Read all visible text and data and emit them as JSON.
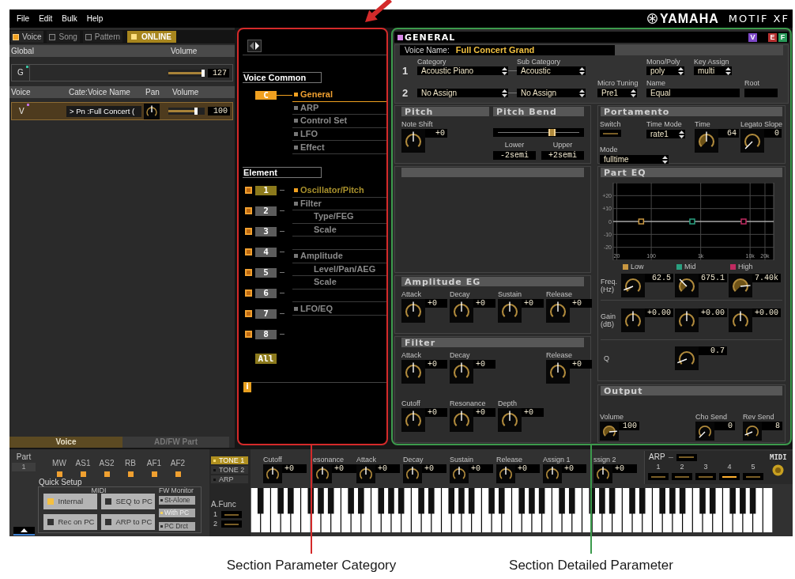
{
  "menu": [
    {
      "label": "File"
    },
    {
      "label": "Edit"
    },
    {
      "label": "Bulk"
    },
    {
      "label": "Help"
    }
  ],
  "logo": {
    "brand": "YAMAHA",
    "model": "MOTIF XF"
  },
  "mode_tabs": [
    {
      "label": "Voice",
      "selected": true
    },
    {
      "label": "Song",
      "selected": false
    },
    {
      "label": "Pattern",
      "selected": false
    }
  ],
  "online": {
    "label": "ONLINE",
    "on": true
  },
  "global": {
    "header": "Global",
    "volume_header": "Volume",
    "row": {
      "label": "G",
      "volume": {
        "value": "127",
        "level": 1
      }
    }
  },
  "voice_list": {
    "columns": [
      "Voice",
      "Cate:Voice Name",
      "Pan",
      "Volume"
    ],
    "rows": [
      {
        "label": "V",
        "name": "> Pn :Full Concert (",
        "selected": true,
        "pan": {
          "kind": "center"
        },
        "volume": {
          "value": "100",
          "level": 0.79
        }
      }
    ]
  },
  "left_tabs": [
    {
      "label": "Voice",
      "selected": true
    },
    {
      "label": "AD/FW Part",
      "selected": false
    }
  ],
  "category": {
    "common": {
      "title": "Voice Common",
      "button": {
        "label": "C",
        "selected": true
      },
      "items": [
        {
          "label": "General",
          "selected": true
        },
        {
          "label": "ARP",
          "selected": false
        },
        {
          "label": "Control Set",
          "selected": false
        },
        {
          "label": "LFO",
          "selected": false
        },
        {
          "label": "Effect",
          "selected": false
        }
      ]
    },
    "element": {
      "title": "Element",
      "buttons": [
        {
          "label": "1",
          "selected": true,
          "checked": true
        },
        {
          "label": "2",
          "selected": false,
          "checked": true
        },
        {
          "label": "3",
          "selected": false,
          "checked": true
        },
        {
          "label": "4",
          "selected": false,
          "checked": true
        },
        {
          "label": "5",
          "selected": false,
          "checked": true
        },
        {
          "label": "6",
          "selected": false,
          "checked": true
        },
        {
          "label": "7",
          "selected": false,
          "checked": true
        },
        {
          "label": "8",
          "selected": false,
          "checked": true
        }
      ],
      "all_button": {
        "label": "All"
      },
      "items": [
        {
          "label": "Oscillator/Pitch",
          "selected": true
        },
        {
          "label": "Filter",
          "selected": false,
          "children": [
            {
              "label": "Type/FEG",
              "selected": false
            },
            {
              "label": "Scale",
              "selected": false
            }
          ]
        },
        {
          "label": "Amplitude",
          "selected": false,
          "children": [
            {
              "label": "Level/Pan/AEG",
              "selected": false
            },
            {
              "label": "Scale",
              "selected": false
            }
          ]
        },
        {
          "label": "LFO/EQ",
          "selected": false
        }
      ]
    },
    "info_button": {
      "label": "i"
    }
  },
  "detail": {
    "title": "GENERAL",
    "badges": [
      {
        "label": "V",
        "color": "#7e48c8"
      },
      {
        "label": "E",
        "color": "#b83232"
      },
      {
        "label": "F",
        "color": "#2a9a5a"
      }
    ],
    "voice_name": {
      "label": "Voice Name:",
      "value": "Full Concert Grand"
    },
    "category_headers": [
      "Category",
      "Sub Category"
    ],
    "category_rows": [
      {
        "index": "1",
        "category": "Acoustic Piano",
        "sub_category": "Acoustic"
      },
      {
        "index": "2",
        "category": "No Assign",
        "sub_category": "No Assign"
      }
    ],
    "mono_poly": {
      "label": "Mono/Poly",
      "value": "poly"
    },
    "key_assign": {
      "label": "Key Assign",
      "value": "multi"
    },
    "micro_tuning": {
      "label": "Micro Tuning",
      "value": "Pre1"
    },
    "tuning_name": {
      "label": "Name",
      "value": "Equal"
    },
    "root": {
      "label": "Root"
    },
    "pitch": {
      "title": "Pitch",
      "note_shift": {
        "label": "Note Shift",
        "value": "+0",
        "kind": "center"
      }
    },
    "pitch_bend": {
      "title": "Pitch Bend",
      "level": 0.64,
      "lower": {
        "label": "Lower",
        "value": "-2semi"
      },
      "upper": {
        "label": "Upper",
        "value": "+2semi"
      }
    },
    "portamento": {
      "title": "Portamento",
      "switch": {
        "label": "Switch",
        "on": false
      },
      "time_mode": {
        "label": "Time Mode",
        "value": "rate1"
      },
      "time": {
        "label": "Time",
        "value": "64",
        "kind": "center",
        "filled": true
      },
      "legato_slope": {
        "label": "Legato Slope",
        "value": "0",
        "kind": "min"
      },
      "mode": {
        "label": "Mode",
        "value": "fulltime"
      }
    },
    "part_eq": {
      "title": "Part EQ",
      "chart_data": [
        {
          "type": "scatter",
          "log": "x",
          "grid": true,
          "xlim": [
            17,
            30000
          ],
          "ylim": [
            -30,
            30
          ],
          "xticks": [
            {
              "value": 20,
              "label": "20"
            },
            {
              "value": 100,
              "label": "100"
            },
            {
              "value": 1000,
              "label": "1k"
            },
            {
              "value": 10000,
              "label": "10k"
            },
            {
              "value": 20000,
              "label": "20k"
            }
          ],
          "yticks": [
            {
              "value": 20,
              "label": "+20"
            },
            {
              "value": 10,
              "label": "+10"
            },
            {
              "value": 0,
              "label": "0"
            },
            {
              "value": -10,
              "label": "-10"
            },
            {
              "value": -20,
              "label": "-20"
            }
          ],
          "series": [
            {
              "type": "line",
              "x": [
                17,
                30000
              ],
              "values": [
                0,
                0
              ],
              "color": "#d8d8d8"
            },
            {
              "name": "Low",
              "x": [
                62.5
              ],
              "values": [
                0
              ],
              "color": "#c89640",
              "marker": "square"
            },
            {
              "name": "Mid",
              "x": [
                675.1
              ],
              "values": [
                0
              ],
              "color": "#2aa080",
              "marker": "square"
            },
            {
              "name": "High",
              "x": [
                7400
              ],
              "values": [
                0
              ],
              "color": "#c02a60",
              "marker": "square"
            }
          ]
        }
      ],
      "freq": {
        "label": "Freq. (Hz)",
        "knobs": [
          {
            "value": "62.5",
            "kind": "low",
            "filled": true
          },
          {
            "value": "675.1",
            "kind": "midlow",
            "filled": true
          },
          {
            "value": "7.40k",
            "kind": "high",
            "filled": true
          }
        ]
      },
      "gain": {
        "label": "Gain (dB)",
        "knobs": [
          {
            "value": "+0.00",
            "kind": "center"
          },
          {
            "value": "+0.00",
            "kind": "center"
          },
          {
            "value": "+0.00",
            "kind": "center"
          }
        ]
      },
      "q": {
        "label": "Q",
        "knob": {
          "value": "0.7",
          "kind": "low"
        }
      }
    },
    "amplitude_eg": {
      "title": "Amplitude EG",
      "knobs": [
        {
          "label": "Attack",
          "value": "+0",
          "kind": "center"
        },
        {
          "label": "Decay",
          "value": "+0",
          "kind": "center"
        },
        {
          "label": "Sustain",
          "value": "+0",
          "kind": "center"
        },
        {
          "label": "Release",
          "value": "+0",
          "kind": "center"
        }
      ]
    },
    "filter": {
      "title": "Filter",
      "knobs": [
        {
          "label": "Attack",
          "value": "+0",
          "kind": "center"
        },
        {
          "label": "Decay",
          "value": "+0",
          "kind": "center"
        },
        {
          "label": "Release",
          "value": "+0",
          "kind": "center"
        }
      ],
      "knobs_2": [
        {
          "label": "Cutoff",
          "value": "+0",
          "kind": "center"
        },
        {
          "label": "Resonance",
          "value": "+0",
          "kind": "center"
        },
        {
          "label": "Depth",
          "value": "+0",
          "kind": "center"
        }
      ]
    },
    "output": {
      "title": "Output",
      "knobs": [
        {
          "label": "Volume",
          "value": "100",
          "kind": "high",
          "filled": true
        },
        {
          "label": "Cho Send",
          "value": "0",
          "kind": "min"
        },
        {
          "label": "Rev Send",
          "value": "8",
          "kind": "low"
        }
      ]
    }
  },
  "bottom": {
    "part": {
      "label": "Part",
      "value": "1"
    },
    "controllers": [
      {
        "label": "MW",
        "on": true
      },
      {
        "label": "AS1",
        "on": true
      },
      {
        "label": "AS2",
        "on": true
      },
      {
        "label": "RB",
        "on": true
      },
      {
        "label": "AF1",
        "on": true
      },
      {
        "label": "AF2",
        "on": true
      }
    ],
    "quick_setup": {
      "title": "Quick Setup",
      "midi_label": "MIDI",
      "buttons": [
        {
          "label": "Internal",
          "selected": true
        },
        {
          "label": "SEQ to PC",
          "selected": false
        },
        {
          "label": "Rec on PC",
          "selected": false
        },
        {
          "label": "ARP to PC",
          "selected": false
        }
      ]
    },
    "fw_monitor": {
      "title": "FW Monitor",
      "options": [
        {
          "label": "St-Alone",
          "selected": false
        },
        {
          "label": "With PC",
          "selected": true
        },
        {
          "label": "PC Drct",
          "selected": false
        }
      ]
    },
    "tones": [
      {
        "label": "TONE 1",
        "selected": true
      },
      {
        "label": "TONE 2",
        "selected": false
      },
      {
        "label": "ARP",
        "selected": false
      }
    ],
    "assign_func": {
      "label": "A.Func",
      "switches": [
        {
          "label": "1",
          "on": false
        },
        {
          "label": "2",
          "on": false
        }
      ]
    },
    "knobs": [
      {
        "label": "Cutoff",
        "value": "+0",
        "kind": "center"
      },
      {
        "label": "esonance",
        "value": "+0",
        "kind": "center"
      },
      {
        "label": "Attack",
        "value": "+0",
        "kind": "center"
      },
      {
        "label": "Decay",
        "value": "+0",
        "kind": "center"
      },
      {
        "label": "Sustain",
        "value": "+0",
        "kind": "center"
      },
      {
        "label": "Release",
        "value": "+0",
        "kind": "center"
      },
      {
        "label": "Assign 1",
        "value": "+0",
        "kind": "center"
      },
      {
        "label": "ssign 2",
        "value": "+0",
        "kind": "center"
      }
    ],
    "arp": {
      "label": "ARP",
      "on": false,
      "switches": [
        {
          "label": "1",
          "selected": false
        },
        {
          "label": "2",
          "selected": false
        },
        {
          "label": "3",
          "selected": false
        },
        {
          "label": "4",
          "selected": true
        },
        {
          "label": "5",
          "selected": false
        }
      ]
    },
    "midi": {
      "label": "MIDI"
    }
  },
  "annotations": [
    {
      "label": "Section Parameter Category",
      "color": "#d42a2a"
    },
    {
      "label": "Section Detailed Parameter",
      "color": "#3c9a4c"
    }
  ]
}
